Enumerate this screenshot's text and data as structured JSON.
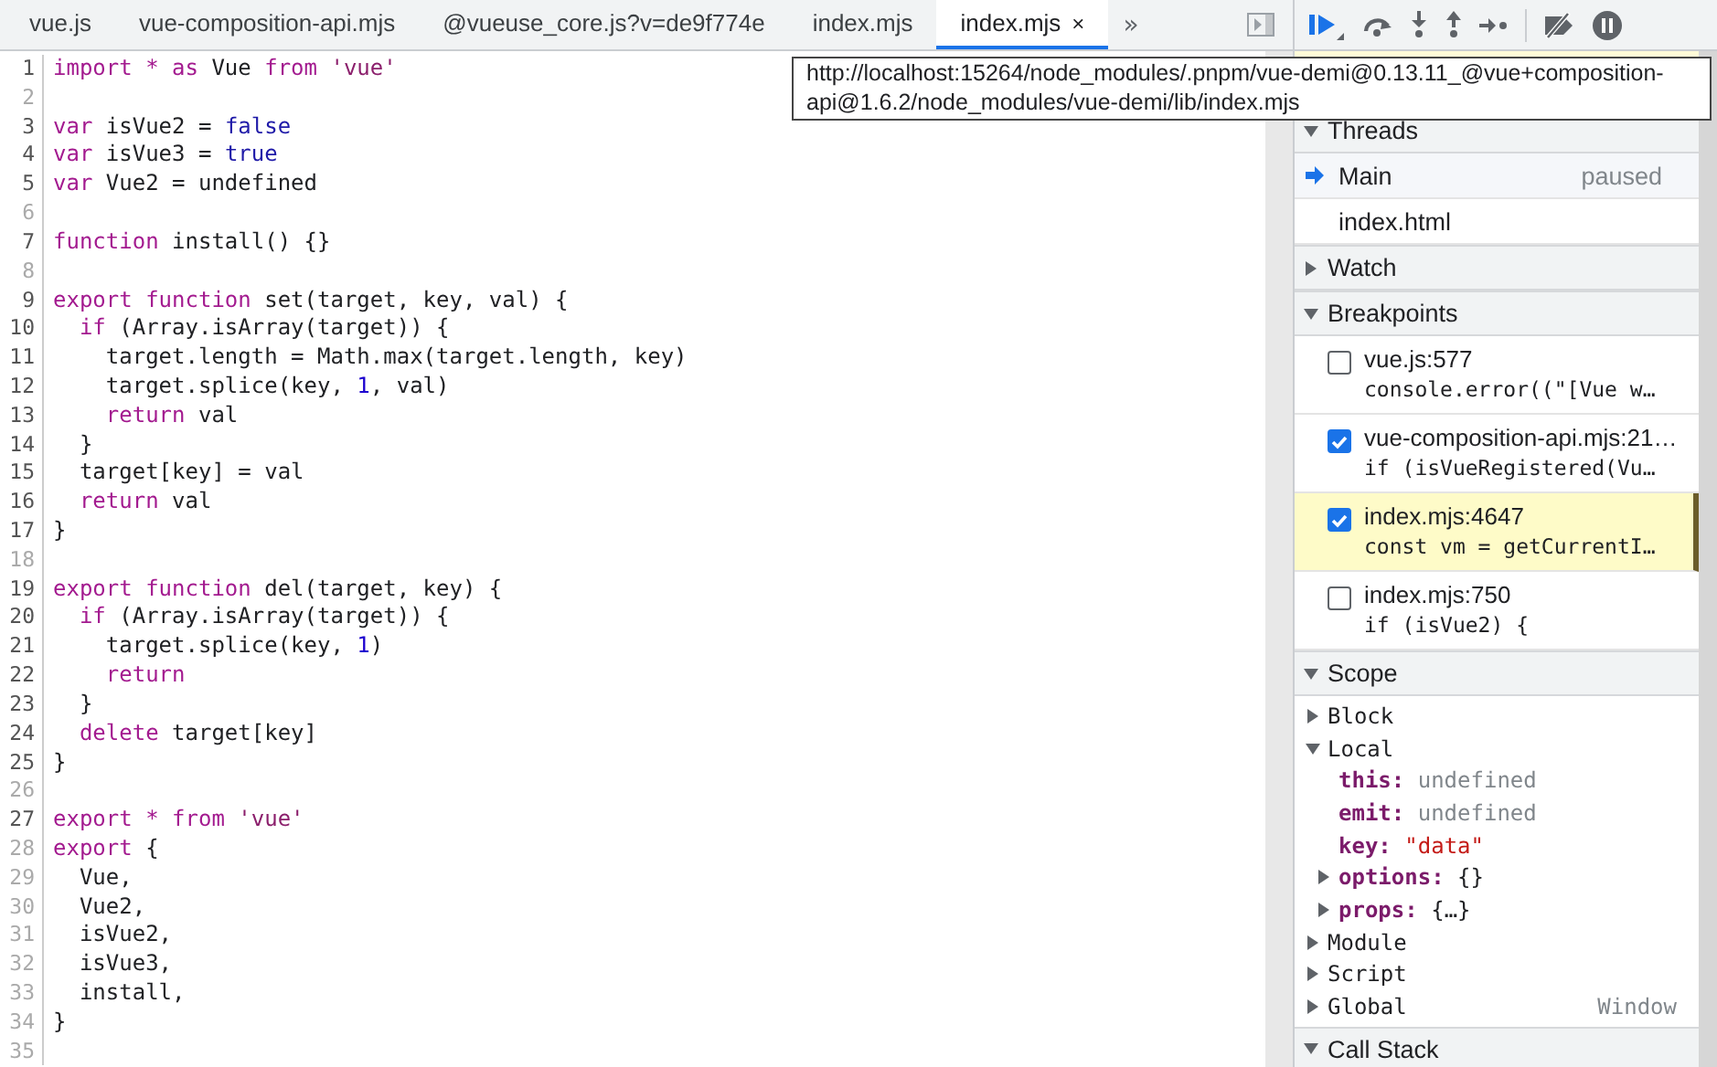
{
  "tabs": [
    {
      "label": "vue.js",
      "selected": false
    },
    {
      "label": "vue-composition-api.mjs",
      "selected": false
    },
    {
      "label": "@vueuse_core.js?v=de9f774e",
      "selected": false
    },
    {
      "label": "index.mjs",
      "selected": false
    },
    {
      "label": "index.mjs",
      "selected": true,
      "close": "×"
    }
  ],
  "overflow": "»",
  "code": [
    {
      "n": "1",
      "muted": false,
      "tokens": [
        {
          "kind": "kw",
          "t": "import * as"
        },
        {
          "kind": "plain",
          "t": " Vue "
        },
        {
          "kind": "kw",
          "t": "from "
        },
        {
          "kind": "str",
          "t": "'vue'"
        }
      ]
    },
    {
      "n": "2",
      "muted": true
    },
    {
      "n": "3",
      "muted": false,
      "tokens": [
        {
          "kind": "kw",
          "t": "var"
        },
        {
          "kind": "plain",
          "t": " isVue2 = "
        },
        {
          "kind": "lit",
          "t": "false"
        }
      ]
    },
    {
      "n": "4",
      "muted": false,
      "tokens": [
        {
          "kind": "kw",
          "t": "var"
        },
        {
          "kind": "plain",
          "t": " isVue3 = "
        },
        {
          "kind": "lit",
          "t": "true"
        }
      ]
    },
    {
      "n": "5",
      "muted": false,
      "tokens": [
        {
          "kind": "kw",
          "t": "var"
        },
        {
          "kind": "plain",
          "t": " Vue2 = undefined"
        }
      ]
    },
    {
      "n": "6",
      "muted": true
    },
    {
      "n": "7",
      "muted": false,
      "tokens": [
        {
          "kind": "kw",
          "t": "function"
        },
        {
          "kind": "plain",
          "t": " install() {}"
        }
      ]
    },
    {
      "n": "8",
      "muted": true
    },
    {
      "n": "9",
      "muted": false,
      "tokens": [
        {
          "kind": "kw",
          "t": "export function"
        },
        {
          "kind": "plain",
          "t": " set(target, key, val) {"
        }
      ]
    },
    {
      "n": "10",
      "muted": false,
      "tokens": [
        {
          "kind": "kw",
          "t": "  if"
        },
        {
          "kind": "plain",
          "t": " (Array.isArray(target)) {"
        }
      ]
    },
    {
      "n": "11",
      "muted": false,
      "tokens": [
        {
          "kind": "plain",
          "t": "    target.length = Math.max(target.length, key)"
        }
      ]
    },
    {
      "n": "12",
      "muted": false,
      "tokens": [
        {
          "kind": "plain",
          "t": "    target.splice(key, "
        },
        {
          "kind": "num",
          "t": "1"
        },
        {
          "kind": "plain",
          "t": ", val)"
        }
      ]
    },
    {
      "n": "13",
      "muted": false,
      "tokens": [
        {
          "kind": "kw",
          "t": "    return"
        },
        {
          "kind": "plain",
          "t": " val"
        }
      ]
    },
    {
      "n": "14",
      "muted": false,
      "tokens": [
        {
          "kind": "plain",
          "t": "  }"
        }
      ]
    },
    {
      "n": "15",
      "muted": false,
      "tokens": [
        {
          "kind": "plain",
          "t": "  target[key] = val"
        }
      ]
    },
    {
      "n": "16",
      "muted": false,
      "tokens": [
        {
          "kind": "kw",
          "t": "  return"
        },
        {
          "kind": "plain",
          "t": " val"
        }
      ]
    },
    {
      "n": "17",
      "muted": false,
      "tokens": [
        {
          "kind": "plain",
          "t": "}"
        }
      ]
    },
    {
      "n": "18",
      "muted": true
    },
    {
      "n": "19",
      "muted": false,
      "tokens": [
        {
          "kind": "kw",
          "t": "export function"
        },
        {
          "kind": "plain",
          "t": " del(target, key) {"
        }
      ]
    },
    {
      "n": "20",
      "muted": false,
      "tokens": [
        {
          "kind": "kw",
          "t": "  if"
        },
        {
          "kind": "plain",
          "t": " (Array.isArray(target)) {"
        }
      ]
    },
    {
      "n": "21",
      "muted": false,
      "tokens": [
        {
          "kind": "plain",
          "t": "    target.splice(key, "
        },
        {
          "kind": "num",
          "t": "1"
        },
        {
          "kind": "plain",
          "t": ")"
        }
      ]
    },
    {
      "n": "22",
      "muted": false,
      "tokens": [
        {
          "kind": "kw",
          "t": "    return"
        }
      ]
    },
    {
      "n": "23",
      "muted": false,
      "tokens": [
        {
          "kind": "plain",
          "t": "  }"
        }
      ]
    },
    {
      "n": "24",
      "muted": false,
      "tokens": [
        {
          "kind": "kw",
          "t": "  delete"
        },
        {
          "kind": "plain",
          "t": " target[key]"
        }
      ]
    },
    {
      "n": "25",
      "muted": false,
      "tokens": [
        {
          "kind": "plain",
          "t": "}"
        }
      ]
    },
    {
      "n": "26",
      "muted": true
    },
    {
      "n": "27",
      "muted": false,
      "tokens": [
        {
          "kind": "kw",
          "t": "export * from "
        },
        {
          "kind": "str",
          "t": "'vue'"
        }
      ]
    },
    {
      "n": "28",
      "muted": true,
      "tokens": [
        {
          "kind": "kw",
          "t": "export"
        },
        {
          "kind": "plain",
          "t": " {"
        }
      ]
    },
    {
      "n": "29",
      "muted": true,
      "tokens": [
        {
          "kind": "plain",
          "t": "  Vue,"
        }
      ]
    },
    {
      "n": "30",
      "muted": true,
      "tokens": [
        {
          "kind": "plain",
          "t": "  Vue2,"
        }
      ]
    },
    {
      "n": "31",
      "muted": true,
      "tokens": [
        {
          "kind": "plain",
          "t": "  isVue2,"
        }
      ]
    },
    {
      "n": "32",
      "muted": true,
      "tokens": [
        {
          "kind": "plain",
          "t": "  isVue3,"
        }
      ]
    },
    {
      "n": "33",
      "muted": true,
      "tokens": [
        {
          "kind": "plain",
          "t": "  install,"
        }
      ]
    },
    {
      "n": "34",
      "muted": true,
      "tokens": [
        {
          "kind": "plain",
          "t": "}"
        }
      ]
    },
    {
      "n": "35",
      "muted": true
    }
  ],
  "tooltip": "http://localhost:15264/node_modules/.pnpm/vue-demi@0.13.11_@vue+composition-api@1.6.2/node_modules/vue-demi/lib/index.mjs",
  "sidebar": {
    "threads": {
      "title": "Threads",
      "items": [
        {
          "name": "Main",
          "status": "paused",
          "selected": true
        },
        {
          "name": "index.html",
          "selected": false
        }
      ]
    },
    "watch": {
      "title": "Watch",
      "expanded": false
    },
    "breakpoints": {
      "title": "Breakpoints",
      "expanded": true,
      "items": [
        {
          "location": "vue.js:577",
          "code": "console.error((\"[Vue w…",
          "checked": false,
          "selected": false
        },
        {
          "location": "vue-composition-api.mjs:21…",
          "code": "if (isVueRegistered(Vu…",
          "checked": true,
          "selected": false
        },
        {
          "location": "index.mjs:4647",
          "code": "const vm = getCurrentI…",
          "checked": true,
          "selected": true
        },
        {
          "location": "index.mjs:750",
          "code": "if (isVue2) {",
          "checked": false,
          "selected": false
        }
      ]
    },
    "scope": {
      "title": "Scope",
      "expanded": true,
      "items": [
        {
          "name": "Block",
          "kind": "group",
          "expanded": false
        },
        {
          "name": "Local",
          "kind": "group",
          "expanded": true,
          "children": [
            {
              "name": "this:",
              "kind": "property",
              "value": {
                "kind": "undefined",
                "text": "undefined"
              }
            },
            {
              "name": "emit:",
              "kind": "property",
              "value": {
                "kind": "undefined",
                "text": "undefined"
              }
            },
            {
              "name": "key:",
              "kind": "property",
              "value": {
                "kind": "string",
                "text": "\"data\""
              }
            },
            {
              "name": "options:",
              "kind": "object",
              "value": {
                "kind": "object",
                "text": "{}"
              },
              "expanded": false
            },
            {
              "name": "props:",
              "kind": "object",
              "value": {
                "kind": "object",
                "text": "{…}"
              },
              "expanded": false
            }
          ]
        },
        {
          "name": "Module",
          "kind": "group",
          "expanded": false
        },
        {
          "name": "Script",
          "kind": "group",
          "expanded": false
        },
        {
          "name": "Global",
          "kind": "group",
          "expanded": false,
          "value": "Window"
        }
      ]
    },
    "call_stack": {
      "title": "Call Stack",
      "expanded": true
    }
  }
}
